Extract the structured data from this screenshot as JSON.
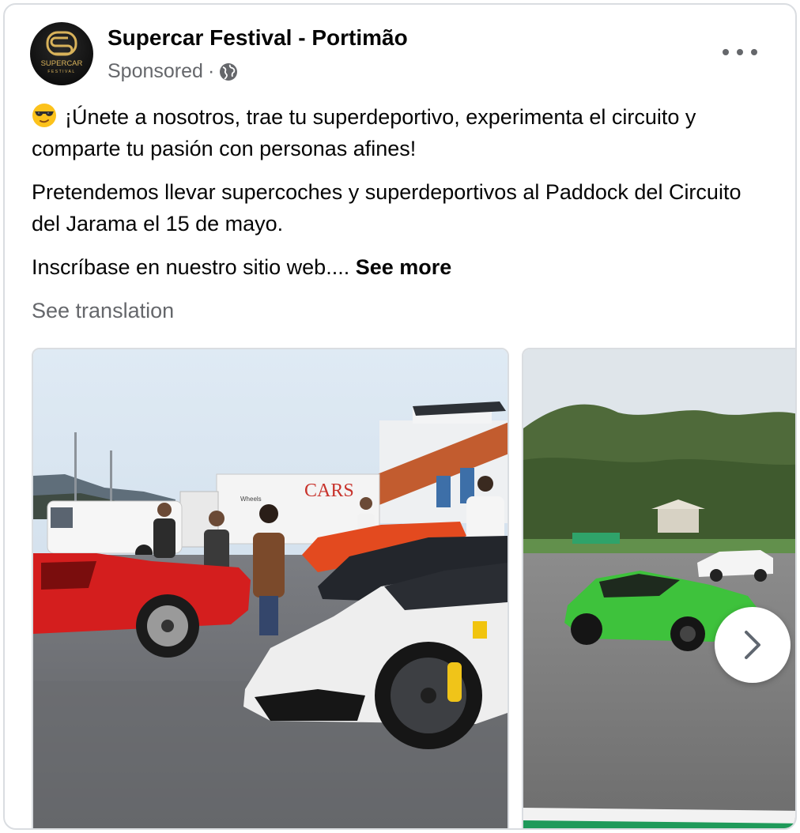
{
  "post": {
    "page_name": "Supercar Festival - Portimão",
    "sponsored_label": "Sponsored",
    "separator": "·",
    "logo_text_main": "SUPERCAR",
    "logo_text_sub": "FESTIVAL",
    "paragraph_1": "¡Únete a nosotros, trae tu superdeportivo, experimenta el circuito y comparte tu pasión con personas afines!",
    "paragraph_2": "Pretendemos llevar supercoches y superdeportivos al Paddock del Circuito del Jarama el 15 de mayo.",
    "paragraph_3": "Inscríbase en nuestro sitio web....",
    "see_more_label": "See more",
    "see_translation_label": "See translation"
  },
  "icons": {
    "more": "more-horizontal-icon",
    "globe": "globe-icon",
    "emoji": "sunglasses-face-icon",
    "next": "chevron-right-icon"
  },
  "carousel": {
    "slides": [
      {
        "signage_text": "CARS",
        "truck_text": "Wheels"
      },
      {
        "signage_text": ""
      }
    ]
  },
  "colors": {
    "text_primary": "#050505",
    "text_secondary": "#65676b",
    "border": "#dadde1",
    "logo_gold": "#d8b25a"
  }
}
